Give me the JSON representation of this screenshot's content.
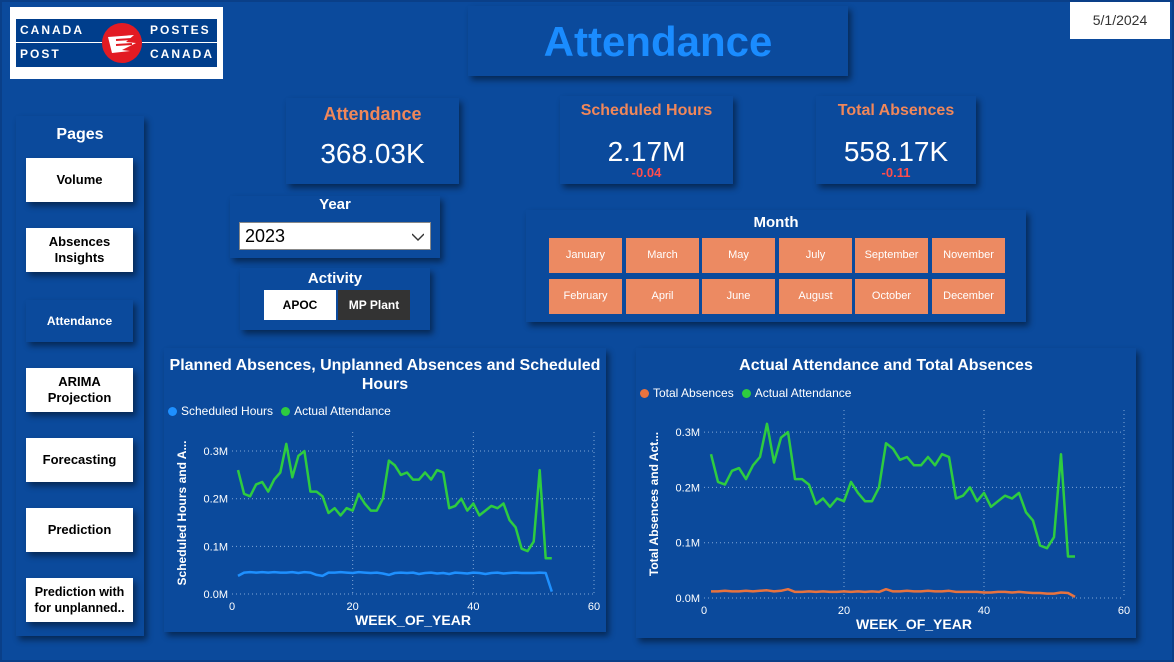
{
  "logo": {
    "tl": "CANADA",
    "tr": "POSTES",
    "bl": "POST",
    "br": "CANADA"
  },
  "title": "Attendance",
  "date": "5/1/2024",
  "pages": {
    "title": "Pages",
    "items": [
      {
        "label": "Volume"
      },
      {
        "label": "Absences Insights"
      },
      {
        "label": "Attendance",
        "active": true
      },
      {
        "label": "ARIMA Projection"
      },
      {
        "label": "Forecasting"
      },
      {
        "label": "Prediction"
      },
      {
        "label": "Prediction with for unplanned.."
      }
    ]
  },
  "kpis": {
    "attendance": {
      "label": "Attendance",
      "value": "368.03K"
    },
    "scheduled": {
      "label": "Scheduled Hours",
      "value": "2.17M",
      "delta": "-0.04"
    },
    "absences": {
      "label": "Total Absences",
      "value": "558.17K",
      "delta": "-0.11"
    }
  },
  "year_slicer": {
    "title": "Year",
    "value": "2023"
  },
  "activity_slicer": {
    "title": "Activity",
    "options": [
      "APOC",
      "MP Plant"
    ]
  },
  "month_slicer": {
    "title": "Month",
    "row1": [
      "January",
      "March",
      "May",
      "July",
      "September",
      "November"
    ],
    "row2": [
      "February",
      "April",
      "June",
      "August",
      "October",
      "December"
    ]
  },
  "colors": {
    "bg": "#0b4a9c",
    "accent_orange": "#ec8a62",
    "green": "#2ecc40",
    "blue": "#1e90ff",
    "orange_line": "#e8733f"
  },
  "chart_data": [
    {
      "type": "line",
      "title": "Planned Absences, Unplanned Absences and Scheduled Hours",
      "xlabel": "WEEK_OF_YEAR",
      "ylabel": "Scheduled Hours and A...",
      "xlim": [
        0,
        60
      ],
      "ylim": [
        0,
        340000
      ],
      "xticks": [
        "0",
        "20",
        "40",
        "60"
      ],
      "yticks": [
        "0.0M",
        "0.1M",
        "0.2M",
        "0.3M"
      ],
      "legend": "top-left",
      "series": [
        {
          "name": "Scheduled Hours",
          "color": "#1e90ff",
          "x": [
            1,
            2,
            3,
            4,
            5,
            6,
            7,
            8,
            9,
            10,
            11,
            12,
            13,
            14,
            15,
            16,
            17,
            18,
            19,
            20,
            21,
            22,
            23,
            24,
            25,
            26,
            27,
            28,
            29,
            30,
            31,
            32,
            33,
            34,
            35,
            36,
            37,
            38,
            39,
            40,
            41,
            42,
            43,
            44,
            45,
            46,
            47,
            48,
            49,
            50,
            51,
            52,
            53
          ],
          "values": [
            38000,
            45000,
            46000,
            45000,
            46000,
            45000,
            46000,
            45000,
            45000,
            46000,
            44000,
            46000,
            45000,
            40000,
            38000,
            45000,
            45000,
            46000,
            45000,
            44000,
            46000,
            45000,
            44000,
            45000,
            43000,
            40000,
            44000,
            45000,
            44000,
            45000,
            42000,
            44000,
            45000,
            43000,
            44000,
            42000,
            45000,
            44000,
            43000,
            45000,
            44000,
            42000,
            44000,
            45000,
            43000,
            44000,
            45000,
            44000,
            44000,
            44000,
            45000,
            44000,
            5000
          ]
        },
        {
          "name": "Actual Attendance",
          "color": "#2ecc40",
          "x": [
            1,
            2,
            3,
            4,
            5,
            6,
            7,
            8,
            9,
            10,
            11,
            12,
            13,
            14,
            15,
            16,
            17,
            18,
            19,
            20,
            21,
            22,
            23,
            24,
            25,
            26,
            27,
            28,
            29,
            30,
            31,
            32,
            33,
            34,
            35,
            36,
            37,
            38,
            39,
            40,
            41,
            42,
            43,
            44,
            45,
            46,
            47,
            48,
            49,
            50,
            51,
            52,
            53
          ],
          "values": [
            260000,
            210000,
            205000,
            230000,
            235000,
            215000,
            240000,
            255000,
            315000,
            245000,
            290000,
            300000,
            215000,
            215000,
            205000,
            170000,
            180000,
            165000,
            180000,
            175000,
            210000,
            190000,
            175000,
            175000,
            200000,
            280000,
            270000,
            250000,
            255000,
            240000,
            240000,
            255000,
            240000,
            260000,
            255000,
            180000,
            185000,
            200000,
            175000,
            190000,
            165000,
            175000,
            185000,
            180000,
            190000,
            155000,
            140000,
            95000,
            90000,
            110000,
            260000,
            75000,
            75000
          ]
        }
      ]
    },
    {
      "type": "line",
      "title": "Actual Attendance and Total Absences",
      "xlabel": "WEEK_OF_YEAR",
      "ylabel": "Total Absences and Act...",
      "xlim": [
        0,
        60
      ],
      "ylim": [
        0,
        340000
      ],
      "xticks": [
        "0",
        "20",
        "40",
        "60"
      ],
      "yticks": [
        "0.0M",
        "0.1M",
        "0.2M",
        "0.3M"
      ],
      "legend": "top-left",
      "series": [
        {
          "name": "Total Absences",
          "color": "#e8733f",
          "x": [
            1,
            2,
            3,
            4,
            5,
            6,
            7,
            8,
            9,
            10,
            11,
            12,
            13,
            14,
            15,
            16,
            17,
            18,
            19,
            20,
            21,
            22,
            23,
            24,
            25,
            26,
            27,
            28,
            29,
            30,
            31,
            32,
            33,
            34,
            35,
            36,
            37,
            38,
            39,
            40,
            41,
            42,
            43,
            44,
            45,
            46,
            47,
            48,
            49,
            50,
            51,
            52,
            53
          ],
          "values": [
            12000,
            12000,
            13000,
            12000,
            12000,
            13000,
            12000,
            13000,
            14000,
            12000,
            13000,
            16000,
            11000,
            11000,
            12000,
            11000,
            12000,
            11000,
            11000,
            12000,
            11000,
            12000,
            11000,
            12000,
            11000,
            16000,
            12000,
            12000,
            13000,
            12000,
            12000,
            13000,
            12000,
            12000,
            13000,
            11000,
            11000,
            11000,
            11000,
            10000,
            10000,
            11000,
            11000,
            10000,
            11000,
            10000,
            9000,
            9000,
            8000,
            8000,
            10000,
            9000,
            2000
          ]
        },
        {
          "name": "Actual Attendance",
          "color": "#2ecc40",
          "x": [
            1,
            2,
            3,
            4,
            5,
            6,
            7,
            8,
            9,
            10,
            11,
            12,
            13,
            14,
            15,
            16,
            17,
            18,
            19,
            20,
            21,
            22,
            23,
            24,
            25,
            26,
            27,
            28,
            29,
            30,
            31,
            32,
            33,
            34,
            35,
            36,
            37,
            38,
            39,
            40,
            41,
            42,
            43,
            44,
            45,
            46,
            47,
            48,
            49,
            50,
            51,
            52,
            53
          ],
          "values": [
            260000,
            210000,
            205000,
            230000,
            235000,
            215000,
            240000,
            255000,
            315000,
            245000,
            290000,
            300000,
            215000,
            215000,
            205000,
            170000,
            180000,
            165000,
            180000,
            175000,
            210000,
            190000,
            175000,
            175000,
            200000,
            280000,
            270000,
            250000,
            255000,
            240000,
            240000,
            255000,
            240000,
            260000,
            255000,
            180000,
            185000,
            200000,
            175000,
            190000,
            165000,
            175000,
            185000,
            180000,
            190000,
            155000,
            140000,
            95000,
            90000,
            110000,
            260000,
            75000,
            75000
          ]
        }
      ]
    }
  ]
}
